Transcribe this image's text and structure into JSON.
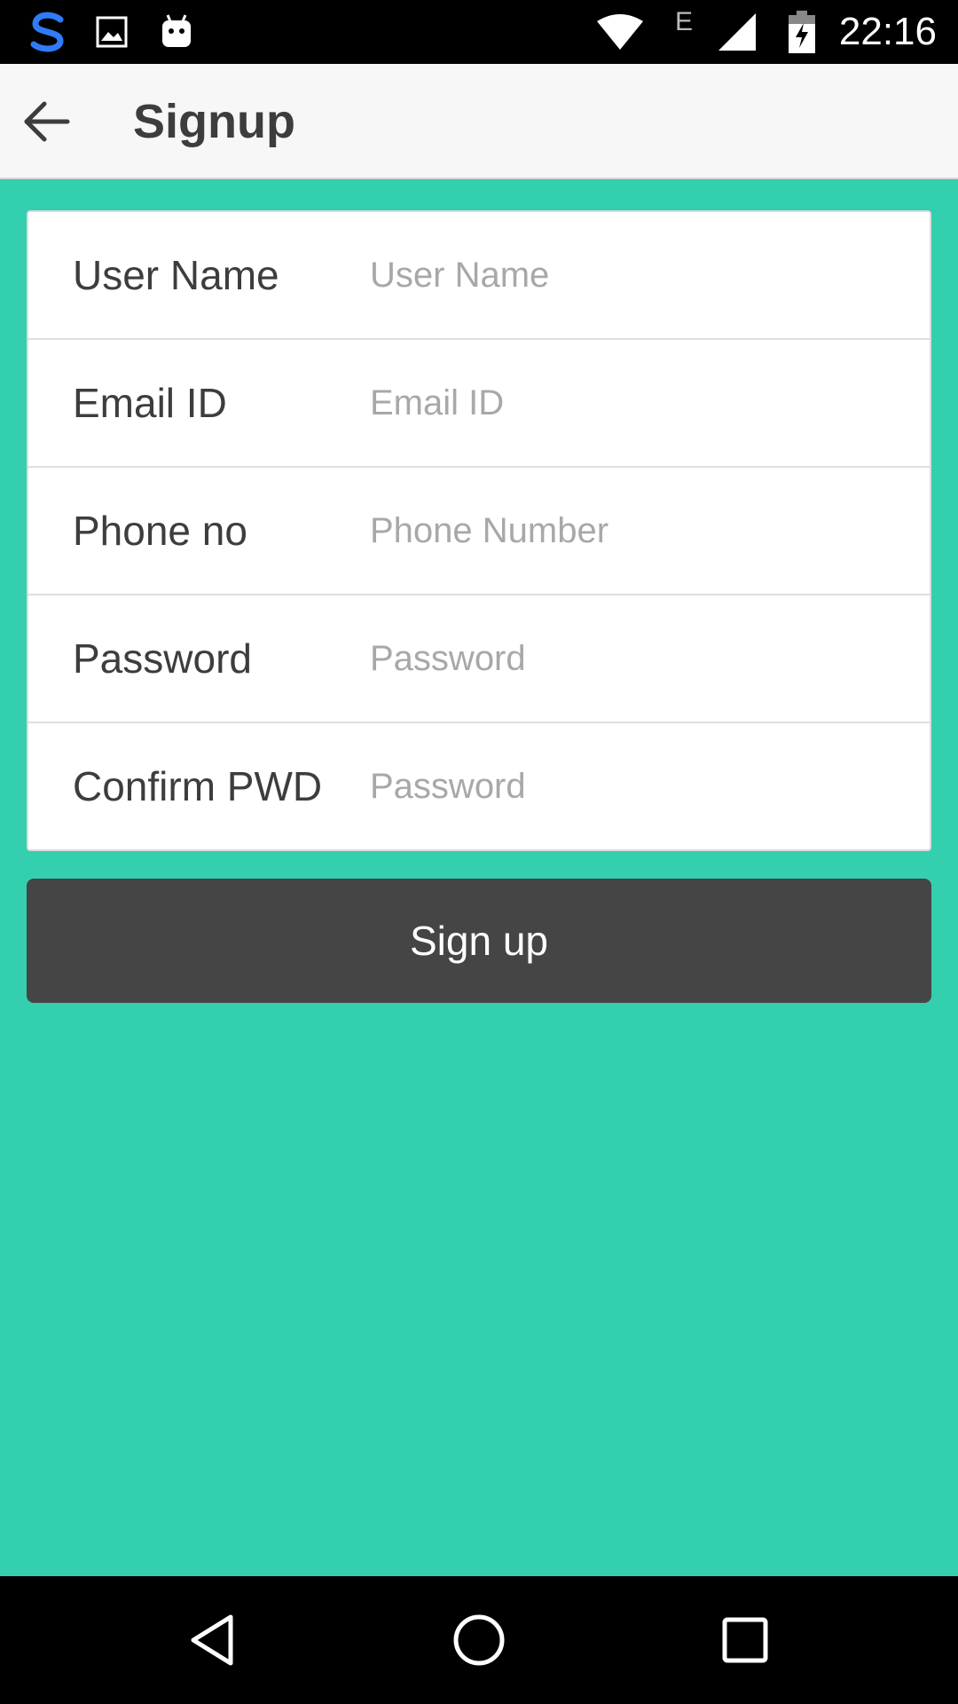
{
  "status_bar": {
    "time": "22:16",
    "network_type": "E",
    "icons": [
      "swiftkey-icon",
      "image-icon",
      "android-icon",
      "wifi-icon",
      "cell-signal-icon",
      "battery-charging-icon"
    ]
  },
  "app_bar": {
    "title": "Signup",
    "back_icon": "arrow-back-icon"
  },
  "form": {
    "rows": [
      {
        "label": "User Name",
        "placeholder": "User Name",
        "value": ""
      },
      {
        "label": "Email ID",
        "placeholder": "Email ID",
        "value": ""
      },
      {
        "label": "Phone no",
        "placeholder": "Phone Number",
        "value": ""
      },
      {
        "label": "Password",
        "placeholder": "Password",
        "value": ""
      },
      {
        "label": "Confirm PWD",
        "placeholder": "Password",
        "value": ""
      }
    ]
  },
  "signup_button": {
    "label": "Sign up"
  },
  "nav_bar": {
    "icons": [
      "nav-back-icon",
      "nav-home-icon",
      "nav-recents-icon"
    ]
  },
  "colors": {
    "background": "#33cfae",
    "button": "#454545",
    "app_bar": "#f7f7f7"
  }
}
